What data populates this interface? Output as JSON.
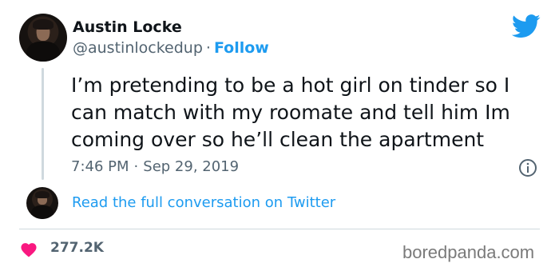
{
  "author": {
    "name": "Austin Locke",
    "handle": "@austinlockedup",
    "separator": "·",
    "follow_label": "Follow"
  },
  "tweet": {
    "text": "I’m pretending to be a hot girl on tinder so I can match with my roomate and tell him Im coming over so he’ll clean the apartment",
    "time": "7:46 PM",
    "separator": "·",
    "date": "Sep 29, 2019"
  },
  "conversation": {
    "link_label": "Read the full conversation on Twitter"
  },
  "engagement": {
    "likes": "277.2K"
  },
  "watermark": "boredpanda.com",
  "icons": {
    "brand": "twitter-bird-icon",
    "info": "info-icon",
    "like": "heart-icon"
  },
  "colors": {
    "accent": "#1d9bf0",
    "heart": "#f91880",
    "text_primary": "#0f1419",
    "text_secondary": "#536471"
  }
}
